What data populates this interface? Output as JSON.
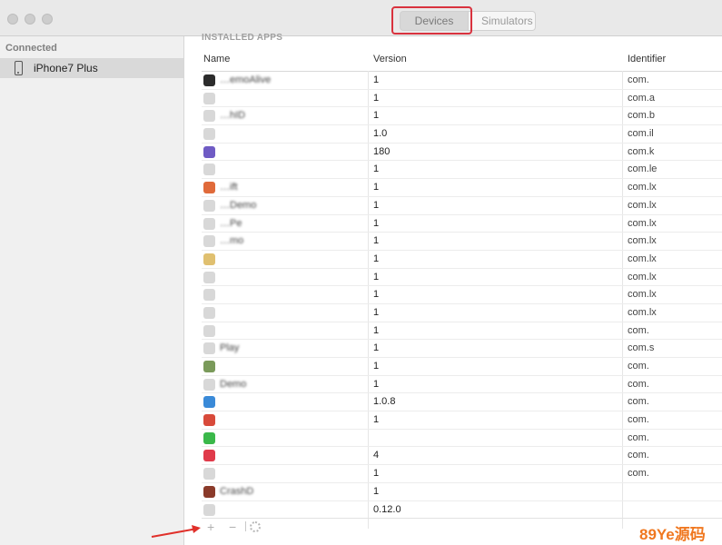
{
  "toolbar": {
    "devices_label": "Devices",
    "simulators_label": "Simulators"
  },
  "sidebar": {
    "header": "Connected",
    "device_name": "iPhone7 Plus"
  },
  "main": {
    "section_title": "INSTALLED APPS",
    "columns": {
      "name": "Name",
      "version": "Version",
      "identifier": "Identifier"
    },
    "apps": [
      {
        "name": "…emoAlive",
        "version": "1",
        "id": "com.",
        "icon": "#2c2c2c"
      },
      {
        "name": "",
        "version": "1",
        "id": "com.a",
        "icon": "#d8d8d8"
      },
      {
        "name": "…hID",
        "version": "1",
        "id": "com.b",
        "icon": "#d8d8d8"
      },
      {
        "name": "",
        "version": "1.0",
        "id": "com.il",
        "icon": "#d8d8d8"
      },
      {
        "name": "",
        "version": "180",
        "id": "com.k",
        "icon": "#6f5bc4"
      },
      {
        "name": "",
        "version": "1",
        "id": "com.le",
        "icon": "#d8d8d8"
      },
      {
        "name": "…ift",
        "version": "1",
        "id": "com.lx",
        "icon": "#e06a3a"
      },
      {
        "name": "…Demo",
        "version": "1",
        "id": "com.lx",
        "icon": "#d8d8d8"
      },
      {
        "name": "…Pe",
        "version": "1",
        "id": "com.lx",
        "icon": "#d8d8d8"
      },
      {
        "name": "…mo",
        "version": "1",
        "id": "com.lx",
        "icon": "#d8d8d8"
      },
      {
        "name": "",
        "version": "1",
        "id": "com.lx",
        "icon": "#e0c070"
      },
      {
        "name": "",
        "version": "1",
        "id": "com.lx",
        "icon": "#d8d8d8"
      },
      {
        "name": "",
        "version": "1",
        "id": "com.lx",
        "icon": "#d8d8d8"
      },
      {
        "name": "",
        "version": "1",
        "id": "com.lx",
        "icon": "#d8d8d8"
      },
      {
        "name": "",
        "version": "1",
        "id": "com.",
        "icon": "#d8d8d8"
      },
      {
        "name": "Play",
        "version": "1",
        "id": "com.s",
        "icon": "#d8d8d8"
      },
      {
        "name": "",
        "version": "1",
        "id": "com.",
        "icon": "#7a9a5a"
      },
      {
        "name": "Demo",
        "version": "1",
        "id": "com.",
        "icon": "#d8d8d8"
      },
      {
        "name": "",
        "version": "1.0.8",
        "id": "com.",
        "icon": "#3a8ad8"
      },
      {
        "name": "",
        "version": "1",
        "id": "com.",
        "icon": "#d84a3a"
      },
      {
        "name": "",
        "version": "",
        "id": "com.",
        "icon": "#3ab84a"
      },
      {
        "name": "",
        "version": "4",
        "id": "com.",
        "icon": "#e03a4a"
      },
      {
        "name": "",
        "version": "1",
        "id": "com.",
        "icon": "#d8d8d8"
      },
      {
        "name": "CrashD",
        "version": "1",
        "id": "",
        "icon": "#8a3a2a"
      },
      {
        "name": "",
        "version": "0.12.0",
        "id": "",
        "icon": "#d8d8d8"
      }
    ]
  },
  "footer": {
    "add_label": "+",
    "remove_label": "−"
  },
  "watermark": {
    "text": "89Ye源码"
  },
  "colors": {
    "highlight": "#d9323e",
    "arrow": "#e0302a"
  }
}
